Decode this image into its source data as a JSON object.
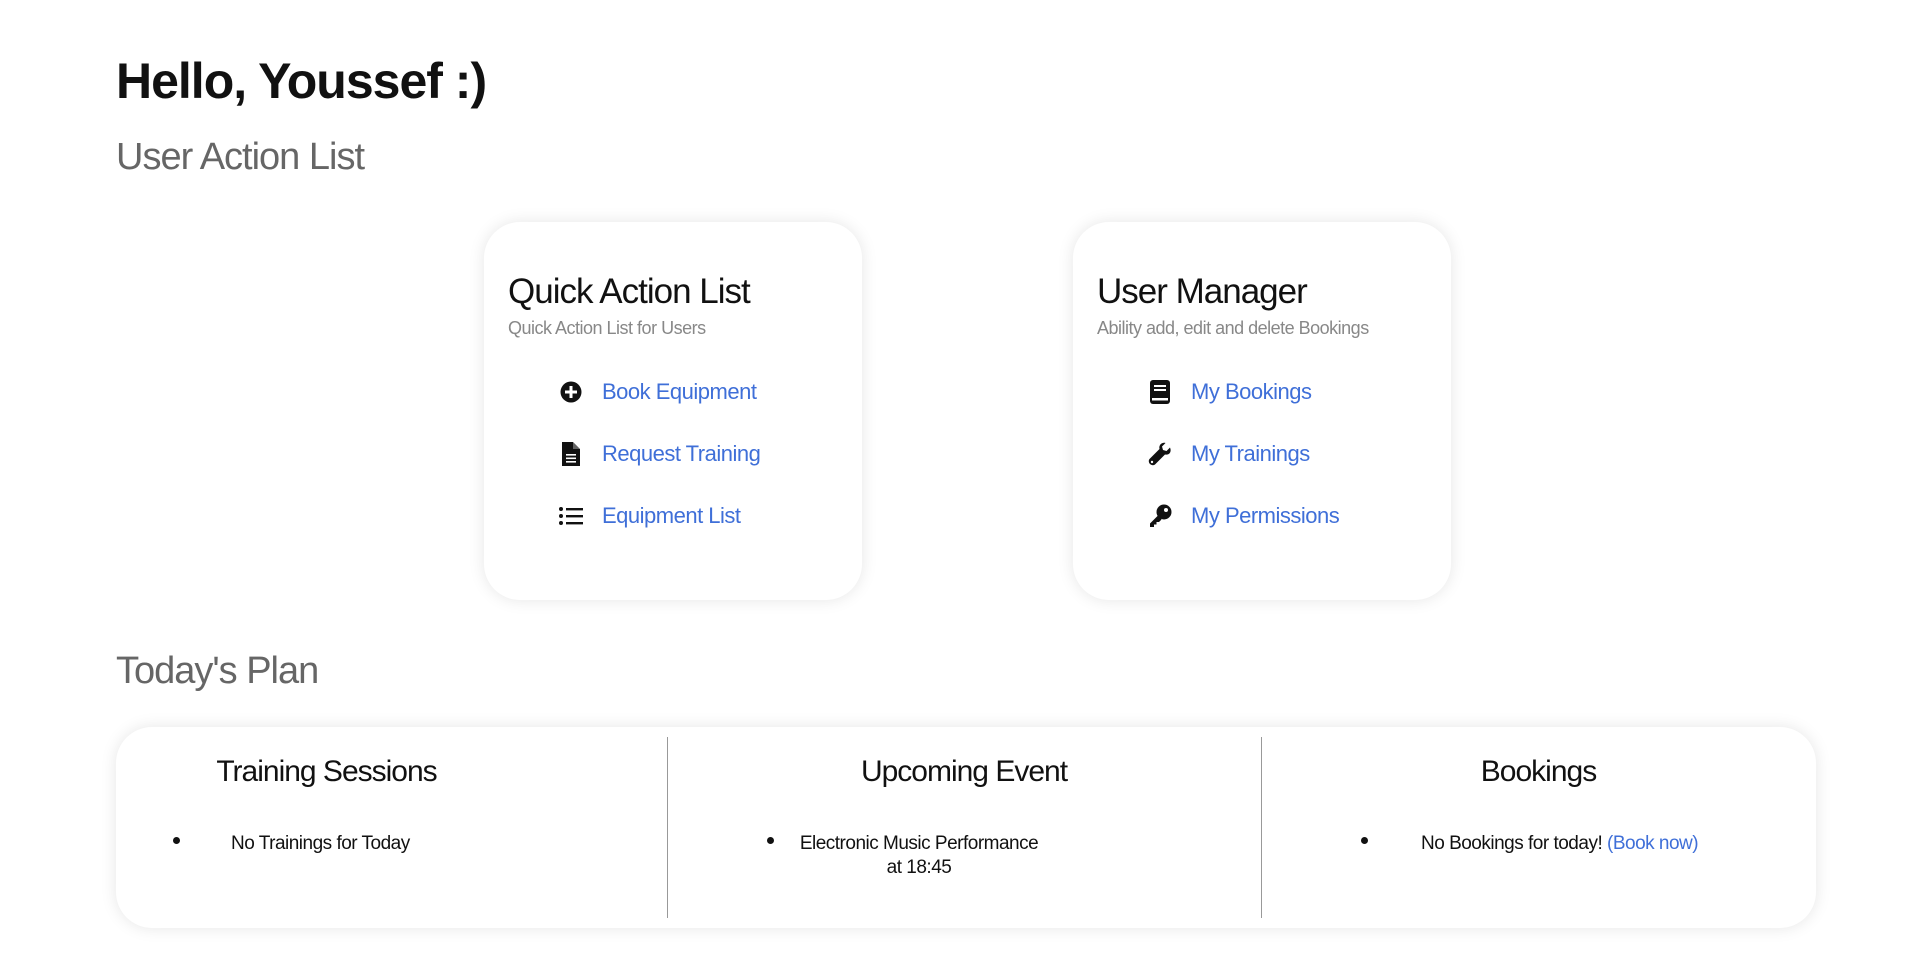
{
  "greeting": "Hello, Youssef :)",
  "sections": {
    "actions_heading": "User Action List",
    "plan_heading": "Today's Plan"
  },
  "quick_actions": {
    "title": "Quick Action List",
    "subtitle": "Quick Action List for Users",
    "items": [
      {
        "label": "Book Equipment",
        "icon": "plus-circle-icon"
      },
      {
        "label": "Request Training",
        "icon": "file-text-icon"
      },
      {
        "label": "Equipment List",
        "icon": "list-icon"
      }
    ]
  },
  "user_manager": {
    "title": "User Manager",
    "subtitle": "Ability add, edit and delete Bookings",
    "items": [
      {
        "label": "My Bookings",
        "icon": "book-icon"
      },
      {
        "label": "My Trainings",
        "icon": "wrench-icon"
      },
      {
        "label": "My Permissions",
        "icon": "key-icon"
      }
    ]
  },
  "plan": {
    "training": {
      "title": "Training Sessions",
      "item": "No Trainings for Today"
    },
    "event": {
      "title": "Upcoming Event",
      "item_line1": "Electronic Music Performance",
      "item_line2": "at 18:45"
    },
    "bookings": {
      "title": "Bookings",
      "item": "No Bookings for today!",
      "link": "(Book now)"
    }
  },
  "colors": {
    "link": "#3f6fd8",
    "heading_muted": "#666666",
    "subtitle": "#888888"
  }
}
